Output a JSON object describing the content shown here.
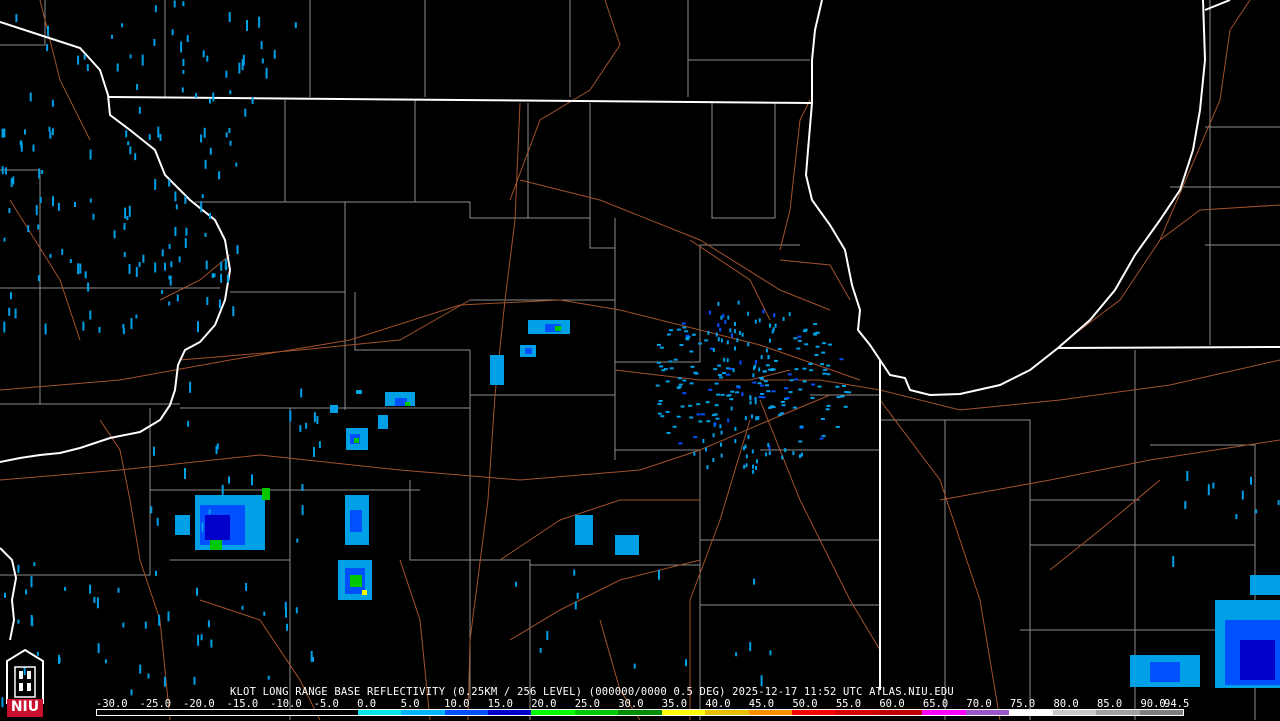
{
  "radar": {
    "caption": "KLOT LONG RANGE BASE REFLECTIVITY (0.25KM / 256 LEVEL) (000000/0000 0.5 DEG) 2025-12-17 11:52 UTC  ATLAS.NIU.EDU",
    "station": "KLOT",
    "product": "LONG RANGE BASE REFLECTIVITY",
    "timestamp": "2025-12-17 11:52 UTC",
    "source": "ATLAS.NIU.EDU"
  },
  "scale": {
    "labels": [
      "-30.0",
      "-25.0",
      "-20.0",
      "-15.0",
      "-10.0",
      "-5.0",
      "0.0",
      "5.0",
      "10.0",
      "15.0",
      "20.0",
      "25.0",
      "30.0",
      "35.0",
      "40.0",
      "45.0",
      "50.0",
      "55.0",
      "60.0",
      "65.0",
      "70.0",
      "75.0",
      "80.0",
      "85.0",
      "90.0",
      "94.5"
    ],
    "colors": [
      "#000000",
      "#000000",
      "#000000",
      "#000000",
      "#000000",
      "#000000",
      "#00e6e6",
      "#00b4ff",
      "#0050ff",
      "#0000c8",
      "#00ff00",
      "#00c800",
      "#008c00",
      "#ffff00",
      "#e6c000",
      "#ff9000",
      "#ff0000",
      "#d40000",
      "#bc0000",
      "#ff00ff",
      "#9955c9",
      "#ffffff",
      "#c8c8c8",
      "#a0a0a0",
      "#808080"
    ]
  },
  "logo": {
    "text": "NIU"
  },
  "colors": {
    "state_border": "#ffffff",
    "county_border": "#8c8c8c",
    "roads": "#a0522d",
    "echo_light": "#00a0e6"
  }
}
